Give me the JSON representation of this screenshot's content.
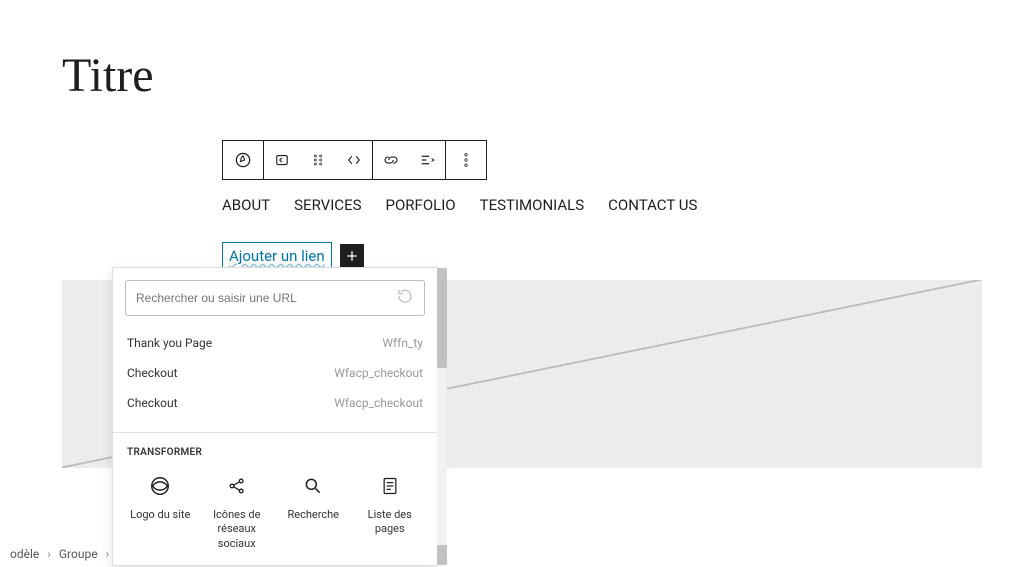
{
  "title": "Titre",
  "nav": {
    "items": [
      "ABOUT",
      "SERVICES",
      "PORFOLIO",
      "TESTIMONIALS",
      "CONTACT US"
    ]
  },
  "link_input": {
    "placeholder_text": "Ajouter un lien"
  },
  "popover": {
    "search_placeholder": "Rechercher ou saisir une URL",
    "suggestions": [
      {
        "name": "Thank you Page",
        "meta": "Wffn_ty"
      },
      {
        "name": "Checkout",
        "meta": "Wfacp_checkout"
      },
      {
        "name": "Checkout",
        "meta": "Wfacp_checkout"
      }
    ],
    "transform_title": "TRANSFORMER",
    "transform_items": [
      {
        "label": "Logo du site"
      },
      {
        "label": "Icônes de réseaux sociaux"
      },
      {
        "label": "Recherche"
      },
      {
        "label": "Liste des pages"
      }
    ]
  },
  "breadcrumb": {
    "items": [
      "odèle",
      "Groupe"
    ]
  }
}
